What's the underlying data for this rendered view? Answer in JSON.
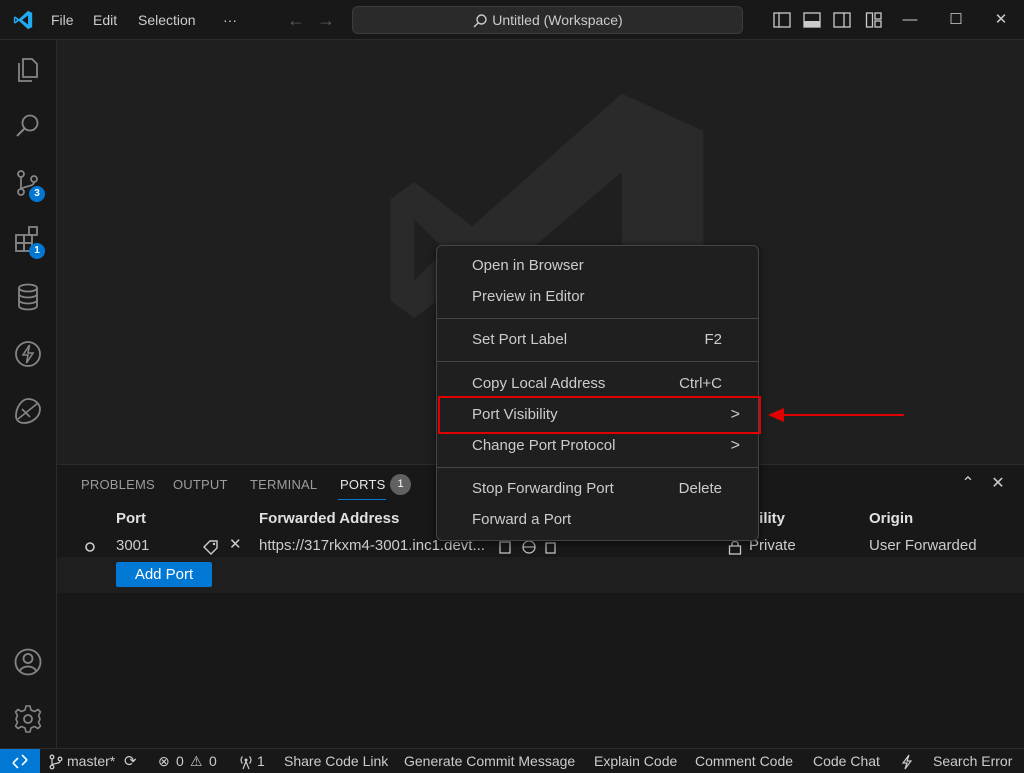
{
  "titlebar": {
    "menus": [
      "File",
      "Edit",
      "Selection",
      "···"
    ],
    "search_text": "Untitled (Workspace)",
    "window_controls": [
      "—",
      "☐",
      "✕"
    ]
  },
  "activity_badges": {
    "source_control": "3",
    "extensions": "1"
  },
  "panel": {
    "tabs": [
      "PROBLEMS",
      "OUTPUT",
      "TERMINAL",
      "PORTS"
    ],
    "ports_count": "1",
    "columns": [
      "Port",
      "Forwarded Address",
      "Visibility",
      "Origin"
    ],
    "visible_column_fragment": "bility",
    "rows": [
      {
        "port": "3001",
        "address": "https://317rkxm4-3001.inc1.devt...",
        "visibility": "Private",
        "origin": "User Forwarded"
      }
    ],
    "add_port_label": "Add Port"
  },
  "context_menu": {
    "group1": [
      {
        "label": "Open in Browser"
      },
      {
        "label": "Preview in Editor"
      }
    ],
    "group2": [
      {
        "label": "Set Port Label",
        "shortcut": "F2"
      }
    ],
    "group3": [
      {
        "label": "Copy Local Address",
        "shortcut": "Ctrl+C"
      },
      {
        "label": "Port Visibility",
        "submenu": ">"
      },
      {
        "label": "Change Port Protocol",
        "submenu": ">"
      }
    ],
    "group4": [
      {
        "label": "Stop Forwarding Port",
        "shortcut": "Delete"
      },
      {
        "label": "Forward a Port"
      }
    ]
  },
  "statusbar": {
    "branch": "master*",
    "errors": "0",
    "warnings": "0",
    "ports": "1",
    "items": [
      "Share Code Link",
      "Generate Commit Message",
      "Explain Code",
      "Comment Code",
      "Code Chat",
      "Search Error"
    ]
  },
  "colors": {
    "accent": "#0078d4",
    "highlight_annotation": "#e00000"
  }
}
